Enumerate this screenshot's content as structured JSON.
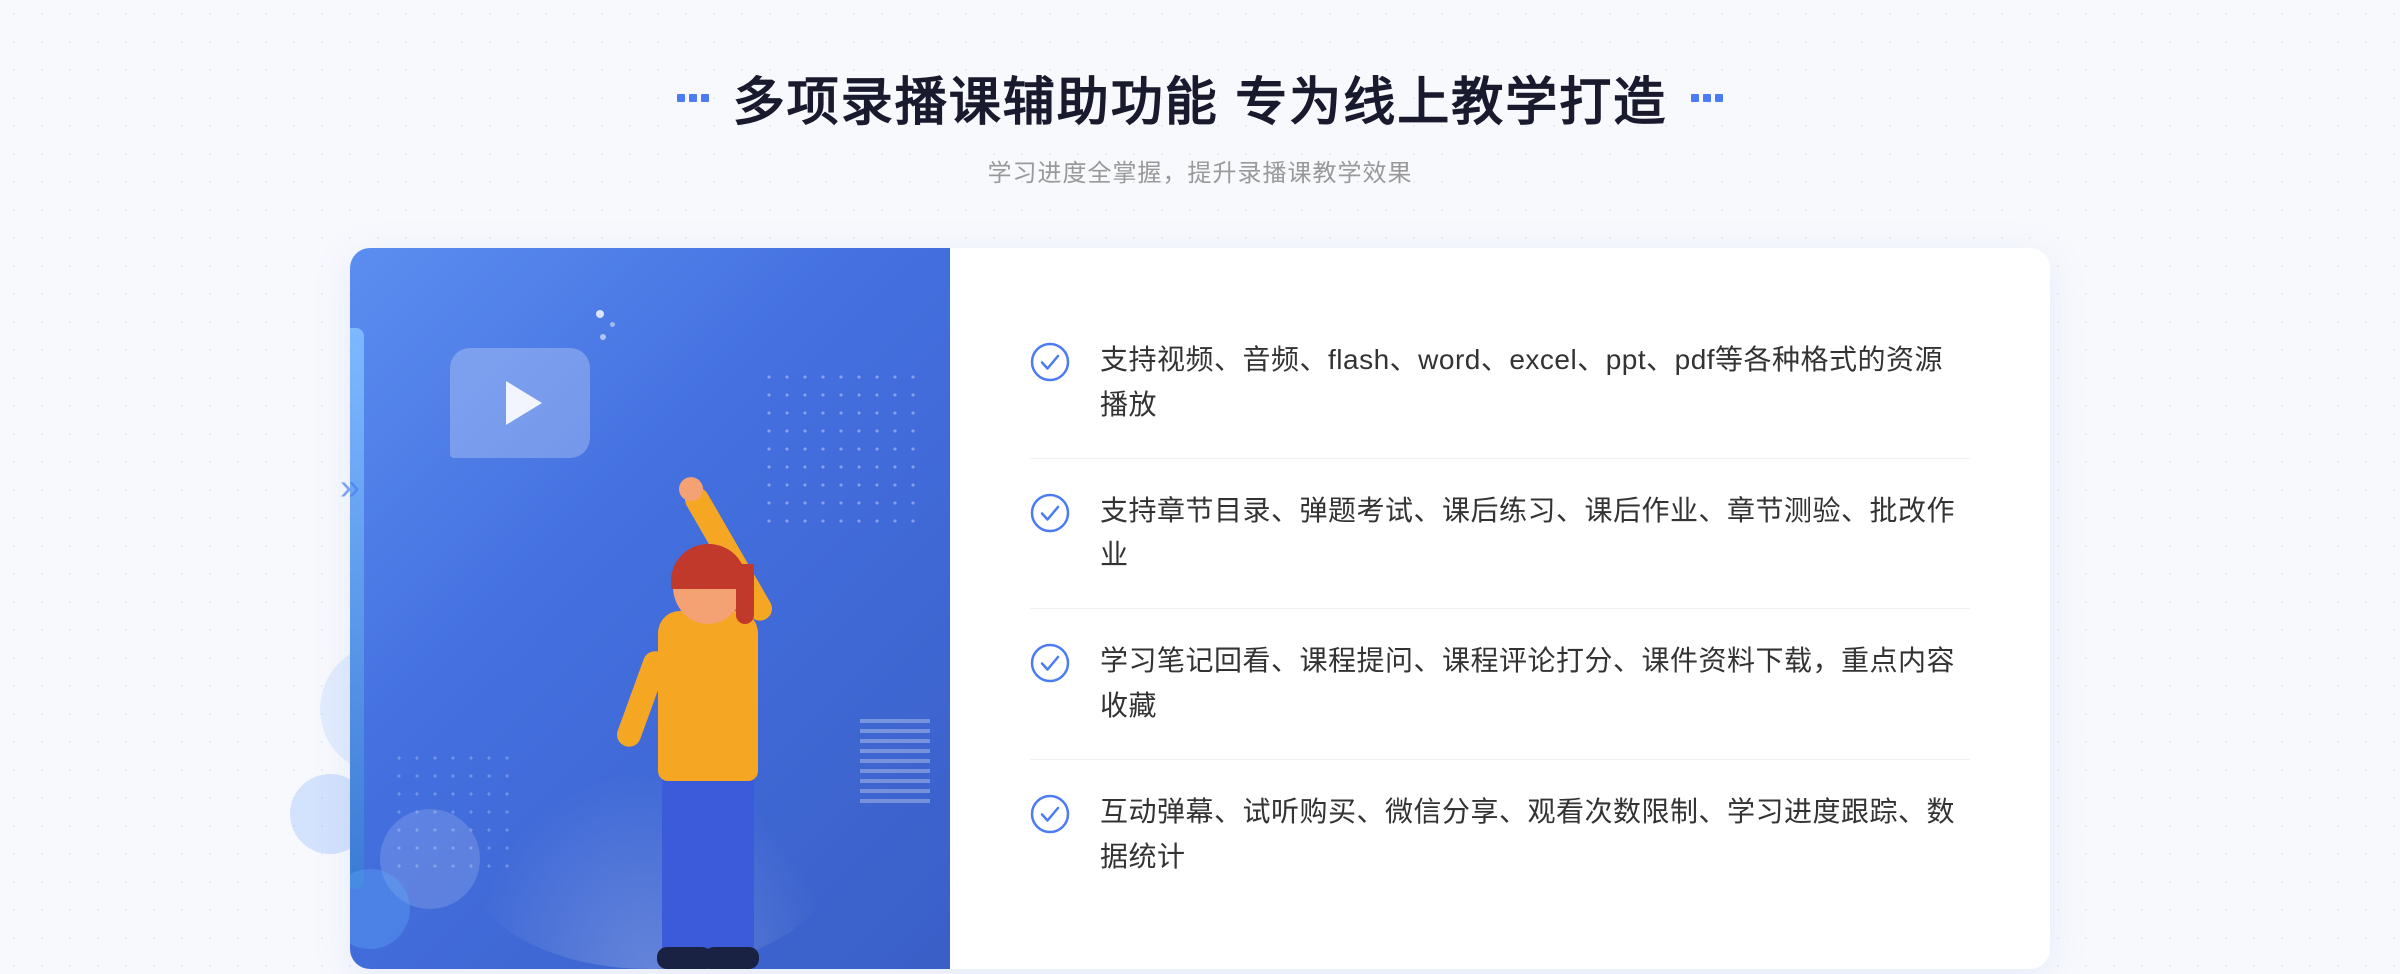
{
  "header": {
    "title": "多项录播课辅助功能 专为线上教学打造",
    "subtitle": "学习进度全掌握，提升录播课教学效果",
    "title_dots_left": "decorative",
    "title_dots_right": "decorative"
  },
  "features": [
    {
      "id": 1,
      "text": "支持视频、音频、flash、word、excel、ppt、pdf等各种格式的资源播放"
    },
    {
      "id": 2,
      "text": "支持章节目录、弹题考试、课后练习、课后作业、章节测验、批改作业"
    },
    {
      "id": 3,
      "text": "学习笔记回看、课程提问、课程评论打分、课件资料下载，重点内容收藏"
    },
    {
      "id": 4,
      "text": "互动弹幕、试听购买、微信分享、观看次数限制、学习进度跟踪、数据统计"
    }
  ],
  "colors": {
    "primary_blue": "#4b7cf3",
    "gradient_start": "#5b8ef0",
    "gradient_end": "#3a5fc7",
    "text_dark": "#1a1a2e",
    "text_gray": "#999",
    "text_body": "#333",
    "check_color": "#4b7cf3"
  },
  "illustration": {
    "play_button": "▶",
    "chevrons": "»"
  }
}
